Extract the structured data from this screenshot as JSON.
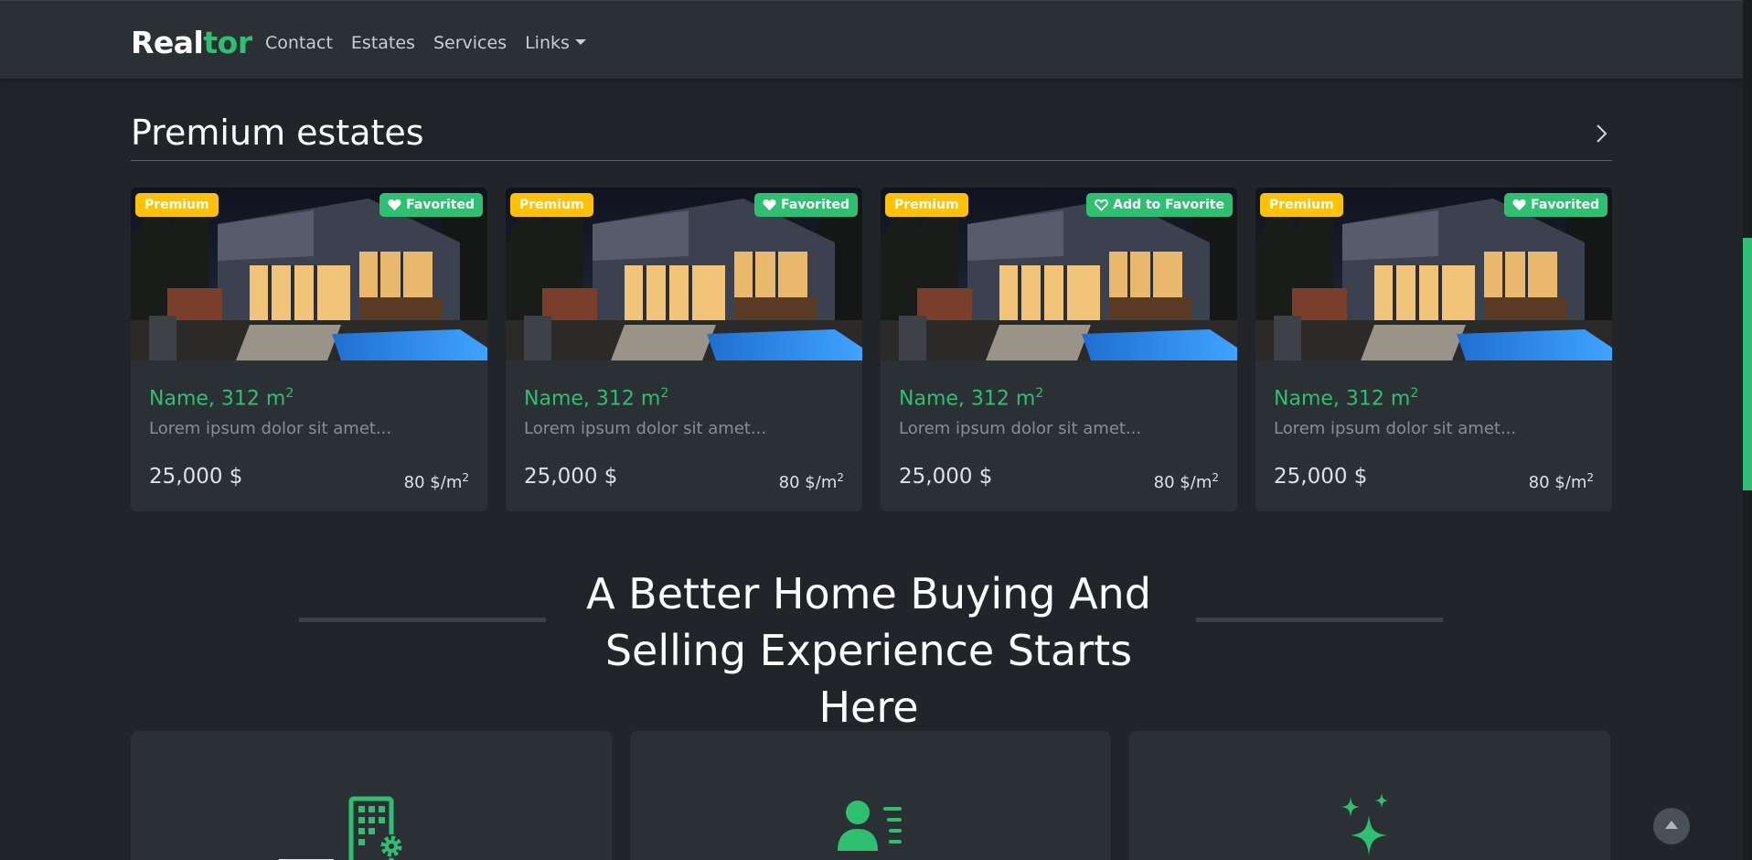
{
  "navbar": {
    "brand_part1": "Real",
    "brand_part2": "tor",
    "links": [
      {
        "label": "Contact"
      },
      {
        "label": "Estates"
      },
      {
        "label": "Services"
      },
      {
        "label": "Links"
      }
    ]
  },
  "premium": {
    "title": "Premium estates",
    "next_icon": "chevron-right-icon",
    "cards": [
      {
        "badge": "Premium",
        "fav_label": "Favorited",
        "fav_icon": "heart-filled-icon",
        "name": "Name, 312 m",
        "name_sup": "2",
        "desc": "Lorem ipsum dolor sit amet...",
        "price": "25,000 $",
        "ppm": "80 $/m",
        "ppm_sup": "2"
      },
      {
        "badge": "Premium",
        "fav_label": "Favorited",
        "fav_icon": "heart-filled-icon",
        "name": "Name, 312 m",
        "name_sup": "2",
        "desc": "Lorem ipsum dolor sit amet...",
        "price": "25,000 $",
        "ppm": "80 $/m",
        "ppm_sup": "2"
      },
      {
        "badge": "Premium",
        "fav_label": "Add to Favorite",
        "fav_icon": "heart-outline-icon",
        "name": "Name, 312 m",
        "name_sup": "2",
        "desc": "Lorem ipsum dolor sit amet...",
        "price": "25,000 $",
        "ppm": "80 $/m",
        "ppm_sup": "2"
      },
      {
        "badge": "Premium",
        "fav_label": "Favorited",
        "fav_icon": "heart-filled-icon",
        "name": "Name, 312 m",
        "name_sup": "2",
        "desc": "Lorem ipsum dolor sit amet...",
        "price": "25,000 $",
        "ppm": "80 $/m",
        "ppm_sup": "2"
      }
    ]
  },
  "hero": {
    "line1": "A Better Home Buying And",
    "line2": "Selling Experience Starts Here"
  },
  "features": [
    {
      "icon": "building-gear-icon"
    },
    {
      "icon": "person-lines-icon"
    },
    {
      "icon": "stars-icon"
    }
  ],
  "colors": {
    "accent": "#2fbf71",
    "premium_badge": "#ffc107",
    "background": "#212529",
    "surface": "#2b3035"
  }
}
